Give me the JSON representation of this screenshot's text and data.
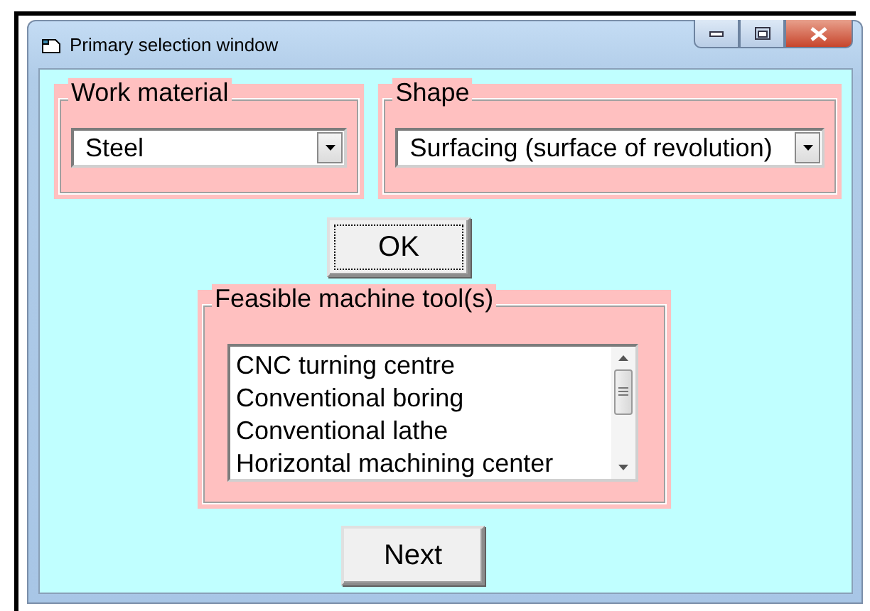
{
  "window": {
    "title": "Primary selection window"
  },
  "work_material": {
    "label": "Work material",
    "value": "Steel"
  },
  "shape": {
    "label": "Shape",
    "value": "Surfacing (surface of revolution)"
  },
  "ok_button": {
    "label": "OK",
    "focused": true
  },
  "feasible_tools": {
    "label": "Feasible machine tool(s)",
    "items": [
      "CNC turning centre",
      "Conventional boring",
      "Conventional lathe",
      "Horizontal machining center"
    ]
  },
  "next_button": {
    "label": "Next",
    "focused": false
  }
}
